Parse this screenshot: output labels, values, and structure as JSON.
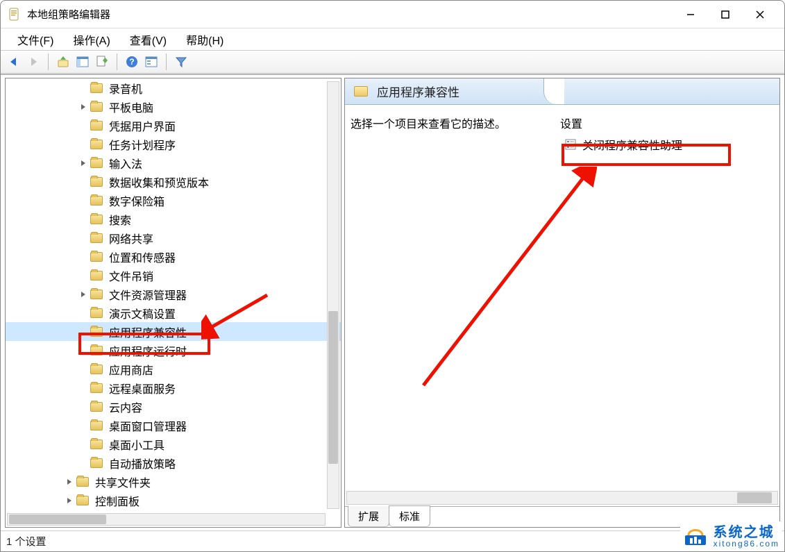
{
  "title": "本地组策略编辑器",
  "menus": {
    "file": "文件(F)",
    "action": "操作(A)",
    "view": "查看(V)",
    "help": "帮助(H)"
  },
  "tree": {
    "items": [
      {
        "label": "录音机",
        "indent": 1,
        "exp": ""
      },
      {
        "label": "平板电脑",
        "indent": 1,
        "exp": ">"
      },
      {
        "label": "凭据用户界面",
        "indent": 1,
        "exp": ""
      },
      {
        "label": "任务计划程序",
        "indent": 1,
        "exp": ""
      },
      {
        "label": "输入法",
        "indent": 1,
        "exp": ">"
      },
      {
        "label": "数据收集和预览版本",
        "indent": 1,
        "exp": ""
      },
      {
        "label": "数字保险箱",
        "indent": 1,
        "exp": ""
      },
      {
        "label": "搜索",
        "indent": 1,
        "exp": ""
      },
      {
        "label": "网络共享",
        "indent": 1,
        "exp": ""
      },
      {
        "label": "位置和传感器",
        "indent": 1,
        "exp": ""
      },
      {
        "label": "文件吊销",
        "indent": 1,
        "exp": ""
      },
      {
        "label": "文件资源管理器",
        "indent": 1,
        "exp": ">"
      },
      {
        "label": "演示文稿设置",
        "indent": 1,
        "exp": ""
      },
      {
        "label": "应用程序兼容性",
        "indent": 1,
        "exp": "",
        "selected": true
      },
      {
        "label": "应用程序运行时",
        "indent": 1,
        "exp": ""
      },
      {
        "label": "应用商店",
        "indent": 1,
        "exp": ""
      },
      {
        "label": "远程桌面服务",
        "indent": 1,
        "exp": ""
      },
      {
        "label": "云内容",
        "indent": 1,
        "exp": ""
      },
      {
        "label": "桌面窗口管理器",
        "indent": 1,
        "exp": ""
      },
      {
        "label": "桌面小工具",
        "indent": 1,
        "exp": ""
      },
      {
        "label": "自动播放策略",
        "indent": 1,
        "exp": ""
      },
      {
        "label": "共享文件夹",
        "indent": 0,
        "exp": ">"
      },
      {
        "label": "控制面板",
        "indent": 0,
        "exp": ">"
      }
    ]
  },
  "right": {
    "header": "应用程序兼容性",
    "desc": "选择一个项目来查看它的描述。",
    "col_setting": "设置",
    "setting": "关闭程序兼容性助理",
    "tab_ext": "扩展",
    "tab_std": "标准"
  },
  "status": "1 个设置",
  "watermark": {
    "top": "系统之城",
    "bot": "xitong86.com"
  }
}
